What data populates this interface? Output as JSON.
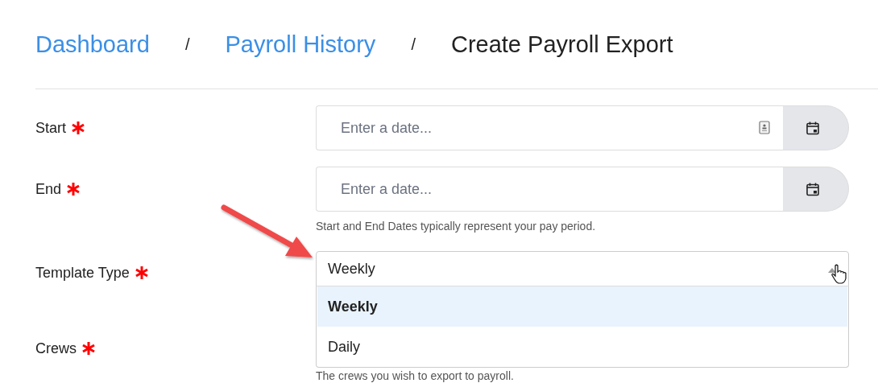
{
  "breadcrumb": {
    "separator": "/",
    "items": [
      {
        "label": "Dashboard",
        "kind": "link"
      },
      {
        "label": "Payroll History",
        "kind": "link"
      },
      {
        "label": "Create Payroll Export",
        "kind": "current"
      }
    ]
  },
  "fields": [
    {
      "label": "Start",
      "required": true,
      "kind": "date",
      "placeholder": "Enter a date...",
      "autofill_icon": true
    },
    {
      "label": "End",
      "required": true,
      "kind": "date",
      "placeholder": "Enter a date...",
      "help": "Start and End Dates typically represent your pay period."
    },
    {
      "label": "Template Type",
      "required": true,
      "kind": "select",
      "value": "Weekly",
      "expanded": true,
      "options": [
        {
          "label": "Weekly",
          "selected": true
        },
        {
          "label": "Daily",
          "selected": false
        }
      ]
    },
    {
      "label": "Crews",
      "required": true,
      "kind": "covered",
      "help": "The crews you wish to export to payroll."
    }
  ],
  "annotation": {
    "kind": "arrow"
  }
}
